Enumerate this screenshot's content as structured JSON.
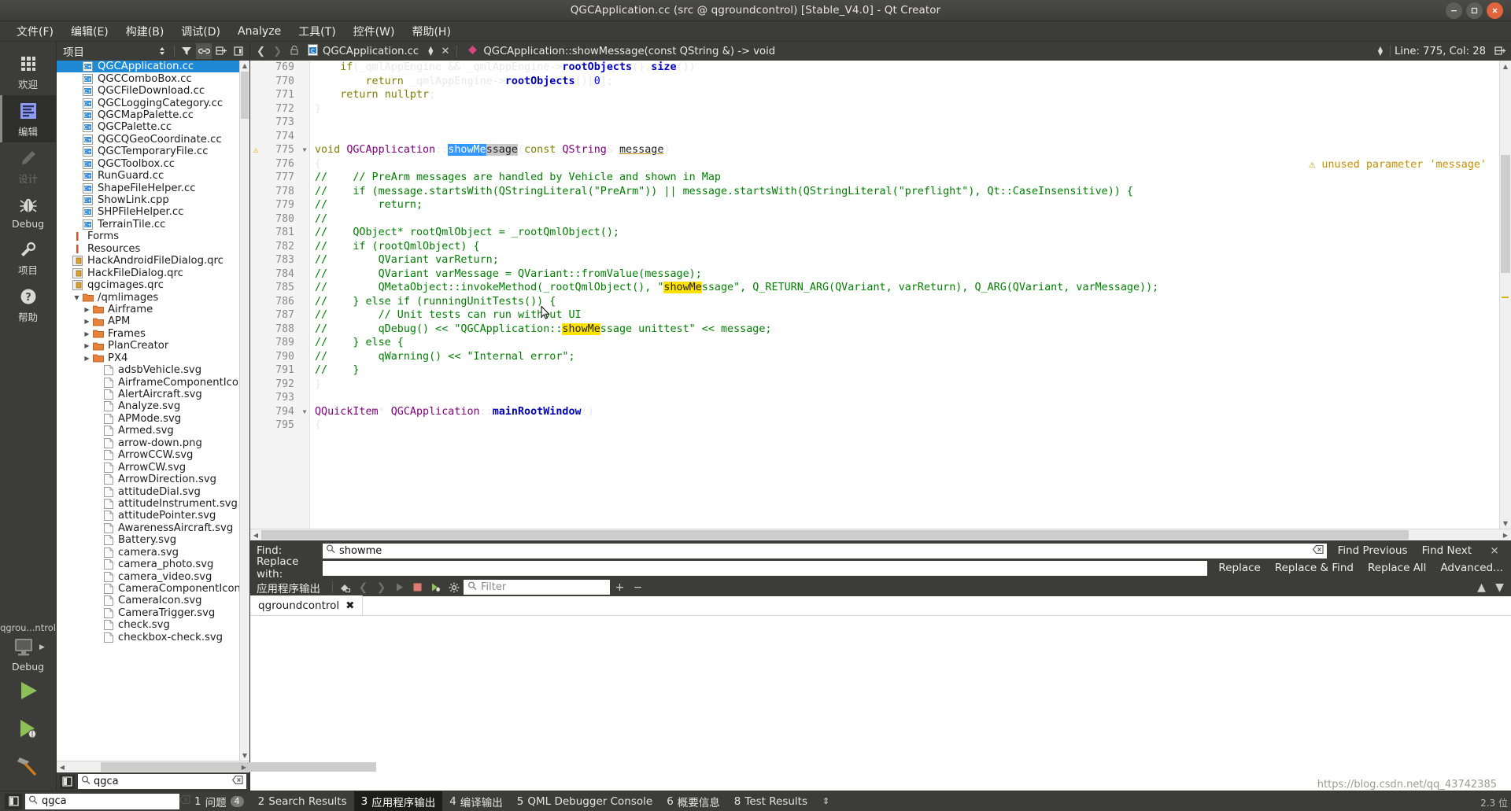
{
  "window": {
    "title": "QGCApplication.cc (src @ qgroundcontrol) [Stable_V4.0] - Qt Creator",
    "minimize_label": "−",
    "maximize_label": "▭",
    "close_label": "×"
  },
  "menubar": {
    "items": [
      {
        "label": "文件(F)",
        "mnemonic": "F"
      },
      {
        "label": "编辑(E)",
        "mnemonic": "E"
      },
      {
        "label": "构建(B)",
        "mnemonic": "B"
      },
      {
        "label": "调试(D)",
        "mnemonic": "D"
      },
      {
        "label": "Analyze",
        "mnemonic": "A"
      },
      {
        "label": "工具(T)",
        "mnemonic": "T"
      },
      {
        "label": "控件(W)",
        "mnemonic": "W"
      },
      {
        "label": "帮助(H)",
        "mnemonic": "H"
      }
    ]
  },
  "modebar": {
    "modes": [
      {
        "label": "欢迎",
        "icon": "grid-icon",
        "state": "normal"
      },
      {
        "label": "编辑",
        "icon": "edit-icon",
        "state": "active"
      },
      {
        "label": "设计",
        "icon": "pencil-icon",
        "state": "disabled"
      },
      {
        "label": "Debug",
        "icon": "bug-icon",
        "state": "normal"
      },
      {
        "label": "项目",
        "icon": "wrench-icon",
        "state": "normal"
      },
      {
        "label": "帮助",
        "icon": "question-icon",
        "state": "normal"
      }
    ],
    "kit_name": "qgrou...ntrol",
    "build_config": "Debug",
    "run_label": "Run",
    "debug_label": "Start Debugging",
    "build_label": "Build"
  },
  "sidebar": {
    "title": "项目",
    "toolbar": [
      {
        "name": "sort-toggle",
        "glyph": "⇕"
      },
      {
        "name": "filter-icon",
        "glyph": "▼"
      },
      {
        "name": "link-with-editor-icon",
        "glyph": "⛓"
      },
      {
        "name": "split-icon",
        "glyph": "⊞"
      },
      {
        "name": "close-split-icon",
        "glyph": "⊡"
      }
    ],
    "search": {
      "value": "qgca",
      "placeholder": ""
    },
    "tree": [
      {
        "label": "QGCApplication.cc",
        "indent": 1,
        "icon": "cpp-file-icon",
        "selected": true
      },
      {
        "label": "QGCComboBox.cc",
        "indent": 1,
        "icon": "cpp-file-icon"
      },
      {
        "label": "QGCFileDownload.cc",
        "indent": 1,
        "icon": "cpp-file-icon"
      },
      {
        "label": "QGCLoggingCategory.cc",
        "indent": 1,
        "icon": "cpp-file-icon"
      },
      {
        "label": "QGCMapPalette.cc",
        "indent": 1,
        "icon": "cpp-file-icon"
      },
      {
        "label": "QGCPalette.cc",
        "indent": 1,
        "icon": "cpp-file-icon"
      },
      {
        "label": "QGCQGeoCoordinate.cc",
        "indent": 1,
        "icon": "cpp-file-icon"
      },
      {
        "label": "QGCTemporaryFile.cc",
        "indent": 1,
        "icon": "cpp-file-icon"
      },
      {
        "label": "QGCToolbox.cc",
        "indent": 1,
        "icon": "cpp-file-icon"
      },
      {
        "label": "RunGuard.cc",
        "indent": 1,
        "icon": "cpp-file-icon"
      },
      {
        "label": "ShapeFileHelper.cc",
        "indent": 1,
        "icon": "cpp-file-icon"
      },
      {
        "label": "ShowLink.cpp",
        "indent": 1,
        "icon": "cpp-file-icon"
      },
      {
        "label": "SHPFileHelper.cc",
        "indent": 1,
        "icon": "cpp-file-icon"
      },
      {
        "label": "TerrainTile.cc",
        "indent": 1,
        "icon": "cpp-file-icon"
      },
      {
        "label": "Forms",
        "indent": 0,
        "icon": "category-icon"
      },
      {
        "label": "Resources",
        "indent": 0,
        "icon": "category-icon"
      },
      {
        "label": "HackAndroidFileDialog.qrc",
        "indent": 0,
        "icon": "qrc-file-icon"
      },
      {
        "label": "HackFileDialog.qrc",
        "indent": 0,
        "icon": "qrc-file-icon"
      },
      {
        "label": "qgcimages.qrc",
        "indent": 0,
        "icon": "qrc-file-icon"
      },
      {
        "label": "/qmlimages",
        "indent": 1,
        "icon": "folder-icon",
        "expander": "down"
      },
      {
        "label": "Airframe",
        "indent": 2,
        "icon": "folder-icon",
        "expander": "right"
      },
      {
        "label": "APM",
        "indent": 2,
        "icon": "folder-icon",
        "expander": "right"
      },
      {
        "label": "Frames",
        "indent": 2,
        "icon": "folder-icon",
        "expander": "right"
      },
      {
        "label": "PlanCreator",
        "indent": 2,
        "icon": "folder-icon",
        "expander": "right"
      },
      {
        "label": "PX4",
        "indent": 2,
        "icon": "folder-icon",
        "expander": "right"
      },
      {
        "label": "adsbVehicle.svg",
        "indent": 3,
        "icon": "generic-file-icon"
      },
      {
        "label": "AirframeComponentIcon.",
        "indent": 3,
        "icon": "generic-file-icon"
      },
      {
        "label": "AlertAircraft.svg",
        "indent": 3,
        "icon": "generic-file-icon"
      },
      {
        "label": "Analyze.svg",
        "indent": 3,
        "icon": "generic-file-icon"
      },
      {
        "label": "APMode.svg",
        "indent": 3,
        "icon": "generic-file-icon"
      },
      {
        "label": "Armed.svg",
        "indent": 3,
        "icon": "generic-file-icon"
      },
      {
        "label": "arrow-down.png",
        "indent": 3,
        "icon": "generic-file-icon"
      },
      {
        "label": "ArrowCCW.svg",
        "indent": 3,
        "icon": "generic-file-icon"
      },
      {
        "label": "ArrowCW.svg",
        "indent": 3,
        "icon": "generic-file-icon"
      },
      {
        "label": "ArrowDirection.svg",
        "indent": 3,
        "icon": "generic-file-icon"
      },
      {
        "label": "attitudeDial.svg",
        "indent": 3,
        "icon": "generic-file-icon"
      },
      {
        "label": "attitudeInstrument.svg",
        "indent": 3,
        "icon": "generic-file-icon"
      },
      {
        "label": "attitudePointer.svg",
        "indent": 3,
        "icon": "generic-file-icon"
      },
      {
        "label": "AwarenessAircraft.svg",
        "indent": 3,
        "icon": "generic-file-icon"
      },
      {
        "label": "Battery.svg",
        "indent": 3,
        "icon": "generic-file-icon"
      },
      {
        "label": "camera.svg",
        "indent": 3,
        "icon": "generic-file-icon"
      },
      {
        "label": "camera_photo.svg",
        "indent": 3,
        "icon": "generic-file-icon"
      },
      {
        "label": "camera_video.svg",
        "indent": 3,
        "icon": "generic-file-icon"
      },
      {
        "label": "CameraComponentIcon.",
        "indent": 3,
        "icon": "generic-file-icon"
      },
      {
        "label": "CameraIcon.svg",
        "indent": 3,
        "icon": "generic-file-icon"
      },
      {
        "label": "CameraTrigger.svg",
        "indent": 3,
        "icon": "generic-file-icon"
      },
      {
        "label": "check.svg",
        "indent": 3,
        "icon": "generic-file-icon"
      },
      {
        "label": "checkbox-check.svg",
        "indent": 3,
        "icon": "generic-file-icon"
      }
    ]
  },
  "editor": {
    "filename": "QGCApplication.cc",
    "symbol": "QGCApplication::showMessage(const QString &) -> void",
    "line_col": "Line: 775, Col: 28",
    "warning_inline": "unused parameter 'message'",
    "lines": [
      {
        "num": "769",
        "html": "    <span class=\"kw\">if</span>(_qmlAppEngine &amp;&amp; _qmlAppEngine-&gt;<span class=\"fn\">rootObjects</span>().<span class=\"fn\">size</span>())"
      },
      {
        "num": "770",
        "html": "        <span class=\"kw\">return</span> _qmlAppEngine-&gt;<span class=\"fn\">rootObjects</span>()[<span class=\"num\">0</span>];"
      },
      {
        "num": "771",
        "html": "    <span class=\"kw\">return</span> <span class=\"kw\">nullptr</span>;"
      },
      {
        "num": "772",
        "html": "}"
      },
      {
        "num": "773",
        "html": ""
      },
      {
        "num": "774",
        "html": ""
      },
      {
        "num": "775",
        "html": "<span class=\"kw\">void</span> <span class=\"ty\">QGCApplication</span>::<span class=\"sel\">showMe</span><span class=\"selgrey\">ssage</span>(<span class=\"kw\">const</span> <span class=\"ty\">QString</span>&amp; <span class=\"param\">message</span>)",
        "marker": "warning",
        "fold": "down"
      },
      {
        "num": "776",
        "html": "{"
      },
      {
        "num": "777",
        "html": "<span class=\"cm\">//    // PreArm messages are handled by Vehicle and shown in Map</span>"
      },
      {
        "num": "778",
        "html": "<span class=\"cm\">//    if (message.startsWith(QStringLiteral(\"PreArm\")) || message.startsWith(QStringLiteral(\"preflight\"), Qt::CaseInsensitive)) {</span>"
      },
      {
        "num": "779",
        "html": "<span class=\"cm\">//        return;</span>"
      },
      {
        "num": "780",
        "html": "<span class=\"cm\">//</span>"
      },
      {
        "num": "781",
        "html": "<span class=\"cm\">//    QObject* rootQmlObject = _rootQmlObject();</span>"
      },
      {
        "num": "782",
        "html": "<span class=\"cm\">//    if (rootQmlObject) {</span>"
      },
      {
        "num": "783",
        "html": "<span class=\"cm\">//        QVariant varReturn;</span>"
      },
      {
        "num": "784",
        "html": "<span class=\"cm\">//        QVariant varMessage = QVariant::fromValue(message);</span>"
      },
      {
        "num": "785",
        "html": "<span class=\"cm\">//        QMetaObject::invokeMethod(_rootQmlObject(), \"</span><span class=\"hl\">showMe</span><span class=\"cm\">ssage\", Q_RETURN_ARG(QVariant, varReturn), Q_ARG(QVariant, varMessage));</span>"
      },
      {
        "num": "786",
        "html": "<span class=\"cm\">//    } else if (runningUnitTests()) {</span>"
      },
      {
        "num": "787",
        "html": "<span class=\"cm\">//        // Unit tests can run without UI</span>"
      },
      {
        "num": "788",
        "html": "<span class=\"cm\">//        qDebug() &lt;&lt; \"QGCApplication::</span><span class=\"hl\">showMe</span><span class=\"cm\">ssage unittest\" &lt;&lt; message;</span>"
      },
      {
        "num": "789",
        "html": "<span class=\"cm\">//    } else {</span>"
      },
      {
        "num": "790",
        "html": "<span class=\"cm\">//        qWarning() &lt;&lt; \"Internal error\";</span>"
      },
      {
        "num": "791",
        "html": "<span class=\"cm\">//    }</span>"
      },
      {
        "num": "792",
        "html": "}"
      },
      {
        "num": "793",
        "html": ""
      },
      {
        "num": "794",
        "html": "<span class=\"ty\">QQuickItem</span>* <span class=\"ty\">QGCApplication</span>::<span class=\"fn\">mainRootWindow</span>()",
        "fold": "down"
      },
      {
        "num": "795",
        "html": "{"
      }
    ]
  },
  "find": {
    "find_label": "Find:",
    "replace_label": "Replace with:",
    "find_value": "showme",
    "replace_value": "",
    "replace_placeholder": "",
    "buttons_row1": [
      "Find Previous",
      "Find Next"
    ],
    "buttons_row2": [
      "Replace",
      "Replace & Find",
      "Replace All",
      "Advanced..."
    ],
    "close_label": "×"
  },
  "output": {
    "title": "应用程序输出",
    "filter_placeholder": "Filter",
    "toolbar": [
      {
        "name": "clear-output-icon",
        "glyph": "⌫"
      },
      {
        "name": "prev-item-icon",
        "glyph": "‹"
      },
      {
        "name": "next-item-icon",
        "glyph": "›"
      },
      {
        "name": "run-icon",
        "glyph": "▶"
      },
      {
        "name": "stop-icon",
        "glyph": "■"
      },
      {
        "name": "attach-debugger-icon",
        "glyph": "▶"
      },
      {
        "name": "settings-gear-icon",
        "glyph": "⚙"
      }
    ],
    "zoom_in_label": "+",
    "zoom_out_label": "−",
    "tabs": [
      {
        "label": "qgroundcontrol",
        "close": "✖",
        "active": true
      }
    ],
    "body_text": ""
  },
  "statusbar": {
    "locator": {
      "value": "qgca",
      "placeholder": ""
    },
    "tabs": [
      {
        "num": "1",
        "label": "问题",
        "badge": "4",
        "active": false
      },
      {
        "num": "2",
        "label": "Search Results",
        "badge": "",
        "active": false
      },
      {
        "num": "3",
        "label": "应用程序输出",
        "badge": "",
        "active": true
      },
      {
        "num": "4",
        "label": "编译输出",
        "badge": "",
        "active": false
      },
      {
        "num": "5",
        "label": "QML Debugger Console",
        "badge": "",
        "active": false
      },
      {
        "num": "6",
        "label": "概要信息",
        "badge": "",
        "active": false
      },
      {
        "num": "8",
        "label": "Test Results",
        "badge": "",
        "active": false
      }
    ],
    "watermark": "https://blog.csdn.net/qq_43742385",
    "watermark2": "2.3 位"
  },
  "colors": {
    "accent": "#1e8ad6",
    "chrome": "#3c3c38",
    "selection": "#3399ff",
    "highlight": "#ffe200",
    "warning": "#c79000",
    "close_button": "#e0643c"
  }
}
